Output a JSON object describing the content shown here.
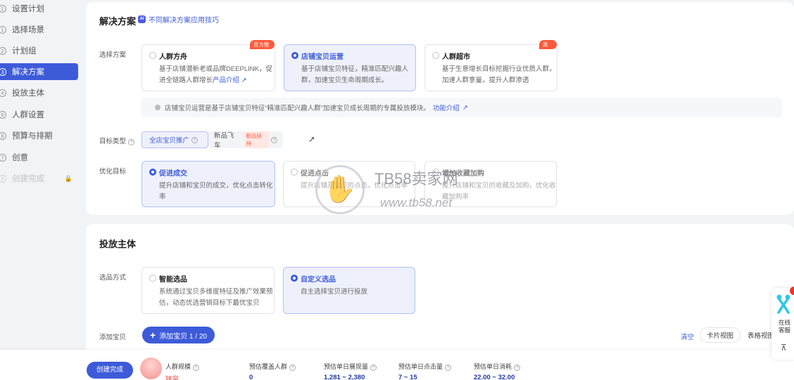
{
  "sidebar": {
    "steps": [
      {
        "num": "1",
        "label": "设置计划"
      },
      {
        "num": "1",
        "label": "选择场景"
      },
      {
        "num": "2",
        "label": "计划组"
      },
      {
        "num": "3",
        "label": "解决方案"
      },
      {
        "num": "4",
        "label": "投放主体"
      },
      {
        "num": "5",
        "label": "人群设置"
      },
      {
        "num": "6",
        "label": "预算与排期"
      },
      {
        "num": "7",
        "label": "创意"
      },
      {
        "num": "8",
        "label": "创建完成"
      }
    ]
  },
  "solution": {
    "title": "解决方案",
    "tip": "不同解决方案应用技巧",
    "ai_badge": "AI",
    "label": "选择方案",
    "options": [
      {
        "title": "人群方舟",
        "desc1": "基于店铺潜新老或品牌DEEPLINK，促",
        "desc2": "进全链路人群增长",
        "link": "产品介绍",
        "tag": "官方推荐"
      },
      {
        "title": "店铺宝贝运营",
        "desc1": "基于店铺宝贝特征，精准匹配兴趣人",
        "desc2": "群，加速宝贝生命周期成长。"
      },
      {
        "title": "人群超市",
        "desc1": "基于生意增长目标挖掘行业优质人群，",
        "desc2": "加速人群拿量，提升人群渗透",
        "tag": "高ROI"
      }
    ],
    "note_text": "店铺宝贝运营是基于店铺宝贝特征“精准匹配兴趣人群”加速宝贝成长周期的专属投放模块。",
    "note_link": "功能介绍",
    "target_label": "目标类型",
    "targets": [
      "全店宝贝推广",
      "新品飞车"
    ],
    "new_tag": "新品扶持",
    "goal_label": "优化目标",
    "goals": [
      {
        "title": "促进成交",
        "desc1": "提升店铺和宝贝的成交，优化点击转化",
        "desc2": "率"
      },
      {
        "title": "促进点击",
        "desc1": "提升店铺及宝贝的点击，优化点击率",
        "desc2": ""
      },
      {
        "title": "增加收藏加购",
        "desc1": "提升店铺和宝贝的收藏及加购，优化收",
        "desc2": "藏加购率"
      }
    ]
  },
  "subject": {
    "title": "投放主体",
    "select_label": "选品方式",
    "options": [
      {
        "title": "智能选品",
        "desc1": "系统通过宝贝多维度特征及推广效果预",
        "desc2": "估，动态优选营销目标下最优宝贝"
      },
      {
        "title": "自定义选品",
        "desc1": "自主选择宝贝进行投放",
        "desc2": ""
      }
    ],
    "add_label": "添加宝贝",
    "add_button": "添加宝贝 1 / 20",
    "clear": "清空",
    "card_view": "卡片视图",
    "table_view": "表格视图"
  },
  "footer": {
    "create_button": "创建完成",
    "metrics": [
      {
        "key": "人群规模",
        "value": "狭窄"
      },
      {
        "key": "预估覆盖人群",
        "value": "0"
      },
      {
        "key": "预估单日展现量",
        "value": "1,281 ~ 2,380"
      },
      {
        "key": "预估单日点击量",
        "value": "7 ~ 15"
      },
      {
        "key": "预估单日消耗",
        "value": "22.00 ~ 32.00"
      }
    ]
  },
  "service": {
    "label_line1": "在线",
    "label_line2": "客服"
  },
  "watermark": {
    "text": "TB58卖家网",
    "url": "www.tb58.net"
  },
  "colors": {
    "accent": "#3d5bd9",
    "tag_red": "#ff5a3c"
  }
}
